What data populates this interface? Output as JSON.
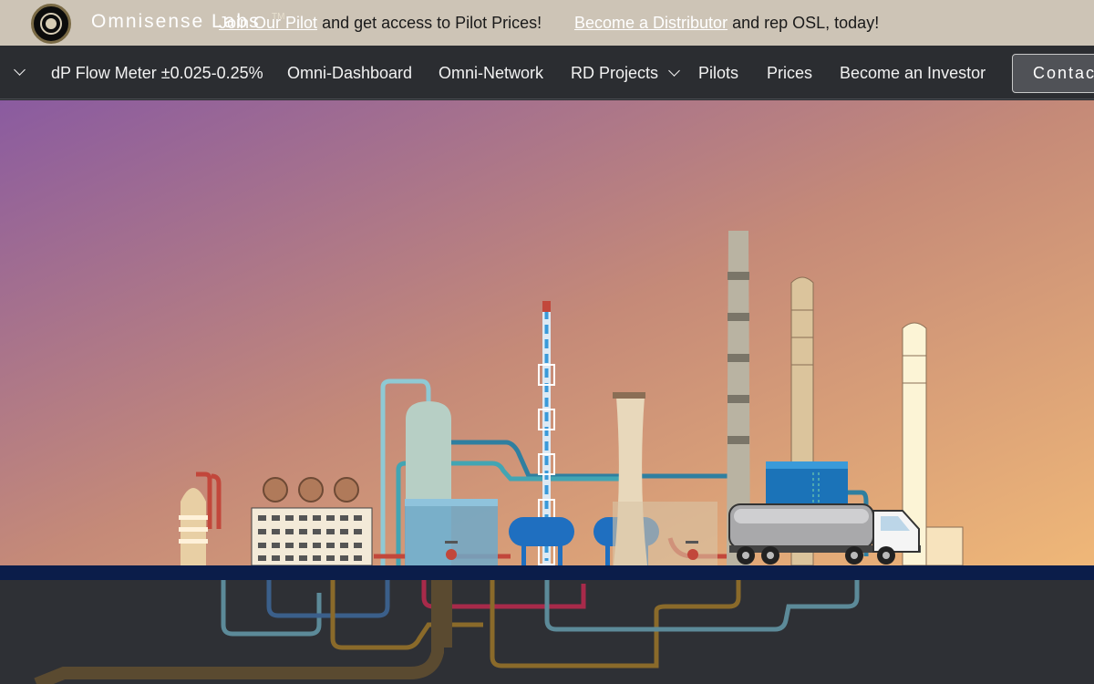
{
  "topbar": {
    "brand": "Omnisense Labs",
    "brand_tm": "TM",
    "promo1_link": "Join Our Pilot",
    "promo1_rest": "and get access to Pilot Prices!",
    "promo2_link": "Become a Distributor",
    "promo2_rest": "and rep OSL, today!"
  },
  "nav": {
    "items": [
      "dP Flow Meter ±0.025-0.25%",
      "Omni-Dashboard",
      "Omni-Network",
      "RD Projects",
      "Pilots",
      "Prices",
      "Become an Investor"
    ],
    "contact_label": "Contact"
  },
  "colors": {
    "topbar_bg": "#cdc4b6",
    "nav_bg": "#2b2d31",
    "sky_top": "#8a5ba0",
    "sky_mid": "#c58a78",
    "sky_bottom": "#f0b878",
    "ground": "#0b1d4a",
    "underground": "#2e3035",
    "pipe_blue": "#3a8fc0",
    "pipe_teal": "#42a5b3",
    "pipe_red": "#c2473b",
    "pipe_gold": "#8a6a2a",
    "pipe_gray": "#5c8a99"
  }
}
